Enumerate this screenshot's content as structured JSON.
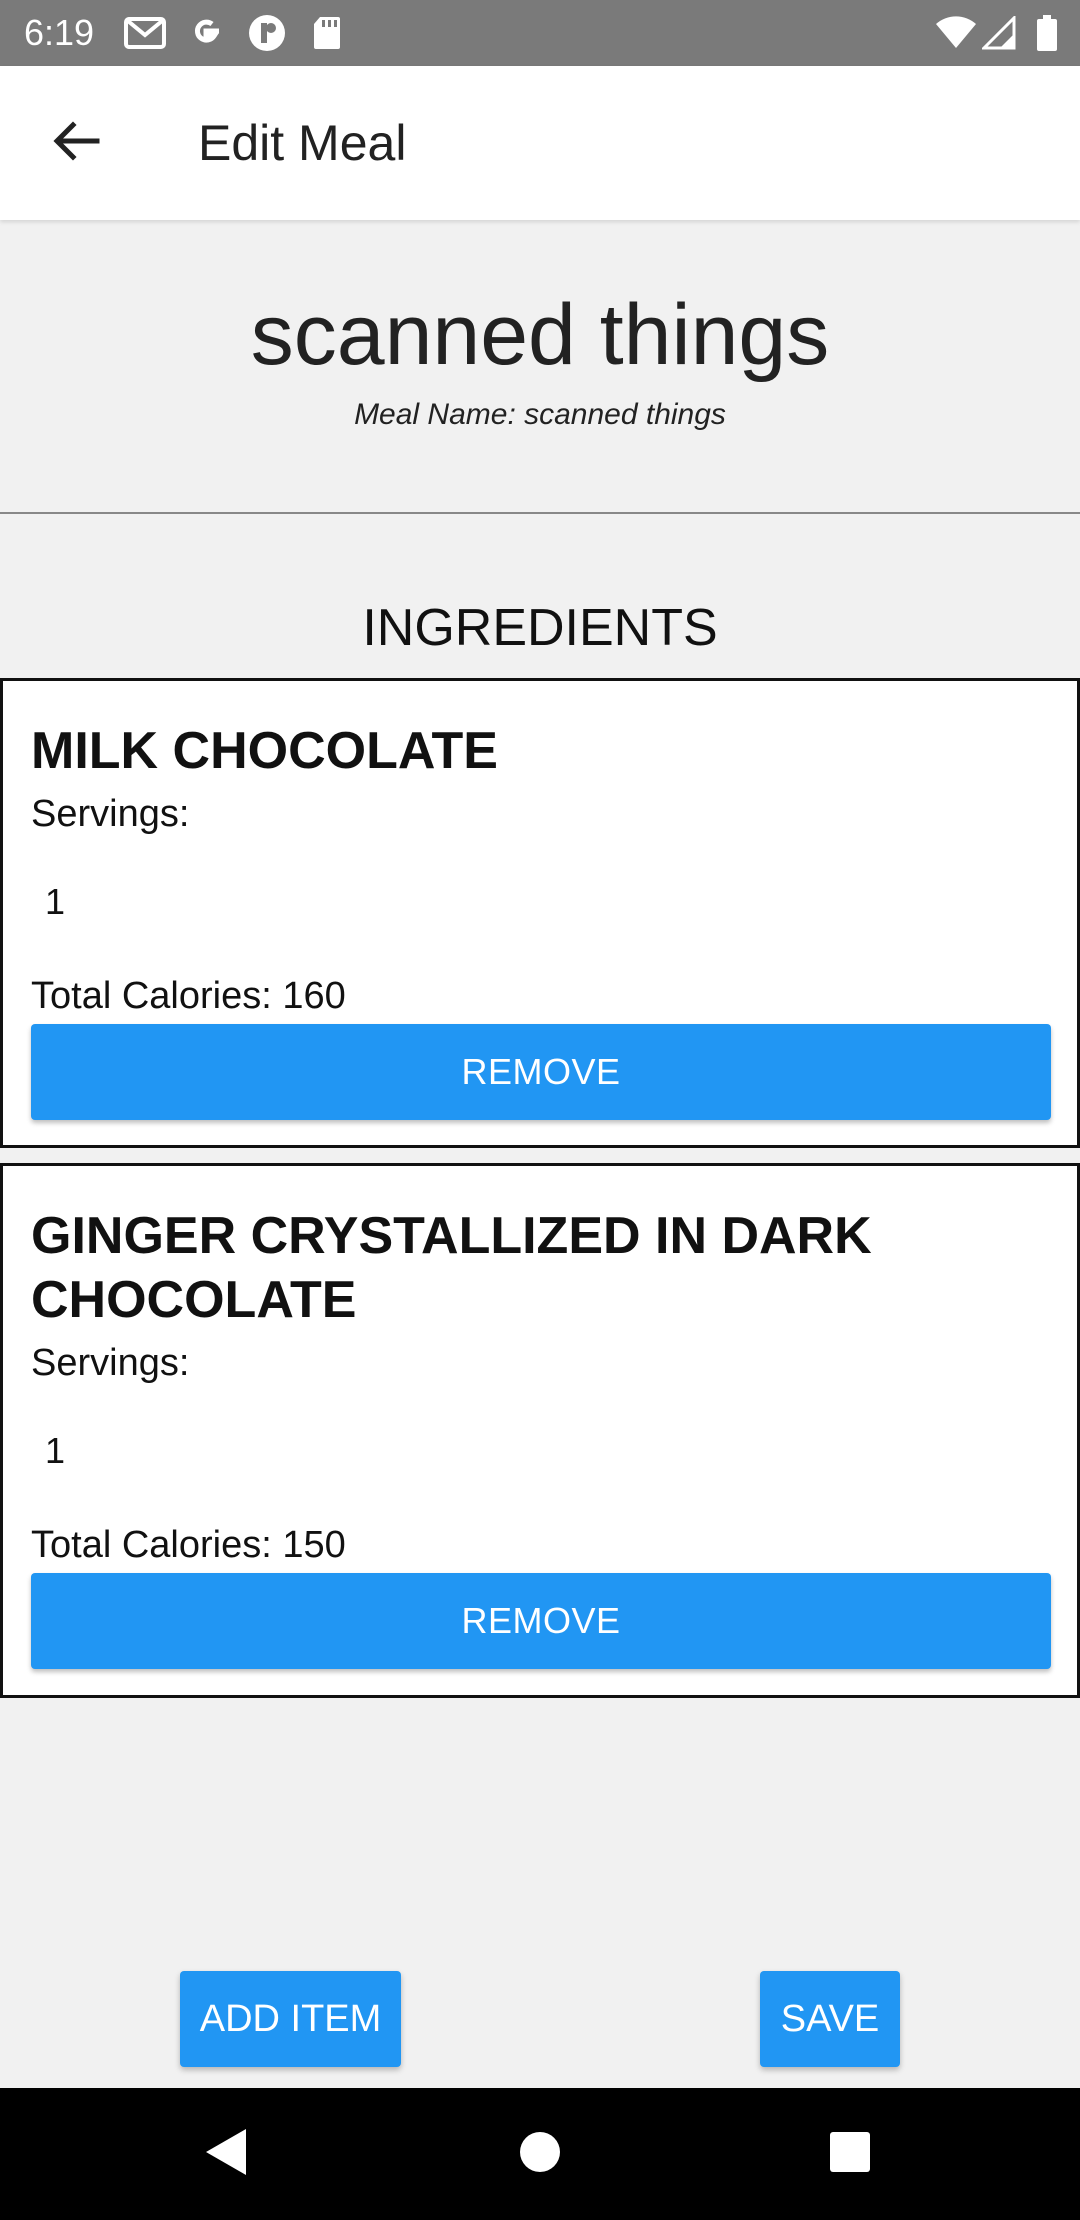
{
  "status_bar": {
    "time": "6:19",
    "left_icons": [
      "gmail-icon",
      "google-icon",
      "app-icon",
      "sd-card-icon"
    ],
    "right_icons": [
      "wifi-icon",
      "signal-icon",
      "battery-icon"
    ]
  },
  "app_bar": {
    "title": "Edit Meal"
  },
  "meal": {
    "name": "scanned things",
    "subtitle": "Meal Name: scanned things"
  },
  "ingredients": {
    "heading": "INGREDIENTS",
    "items": [
      {
        "name": "MILK CHOCOLATE",
        "servings_label": "Servings:",
        "servings_value": "1",
        "calories_text": "Total Calories: 160",
        "remove_label": "REMOVE"
      },
      {
        "name": "GINGER CRYSTALLIZED IN DARK CHOCOLATE",
        "servings_label": "Servings:",
        "servings_value": "1",
        "calories_text": "Total Calories: 150",
        "remove_label": "REMOVE"
      }
    ]
  },
  "actions": {
    "add_label": "ADD ITEM",
    "save_label": "SAVE"
  },
  "colors": {
    "accent": "#2196f3",
    "status_bar": "#7a7a7a",
    "background": "#f1f1f1"
  }
}
